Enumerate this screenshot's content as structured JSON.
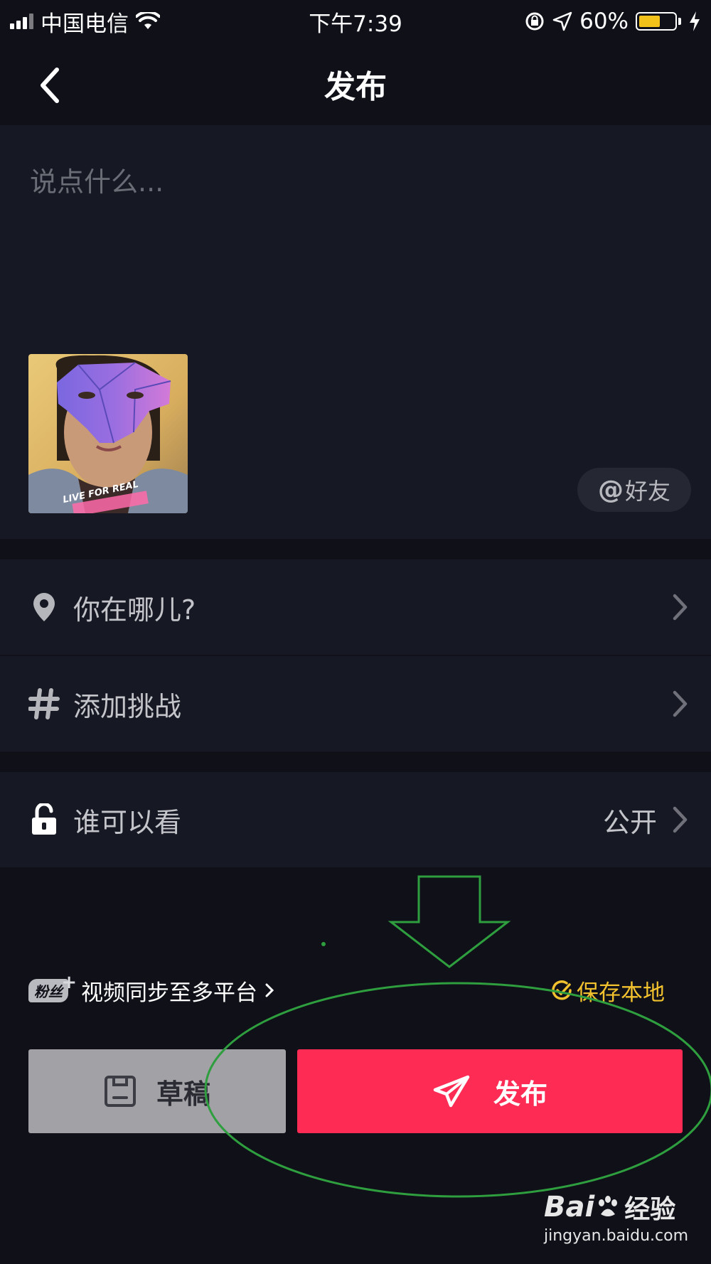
{
  "status_bar": {
    "carrier": "中国电信",
    "time": "下午7:39",
    "battery_percent": "60%",
    "battery_level": 0.6,
    "colors": {
      "battery": "#f3c21a"
    }
  },
  "header": {
    "title": "发布",
    "back_icon": "chevron-left-icon"
  },
  "caption": {
    "placeholder": "说点什么...",
    "at_friend_symbol": "@",
    "at_friend_label": "好友",
    "thumbnail_overlay_text": "LIVE FOR REAL"
  },
  "options": {
    "location_label": "你在哪儿?",
    "challenge_label": "添加挑战",
    "visibility_label": "谁可以看",
    "visibility_value": "公开"
  },
  "sync": {
    "fans_badge": "粉丝",
    "label": "视频同步至多平台",
    "save_local": "保存本地"
  },
  "buttons": {
    "draft": "草稿",
    "publish": "发布"
  },
  "watermark": {
    "brand": "Bai",
    "brand_suffix": "经验",
    "url": "jingyan.baidu.com"
  },
  "colors": {
    "background": "#0f1018",
    "panel": "#161823",
    "publish": "#fe2c55",
    "draft": "#a1a1a6",
    "accent_yellow": "#f2c12e",
    "annotation_green": "#2e9e3e"
  }
}
